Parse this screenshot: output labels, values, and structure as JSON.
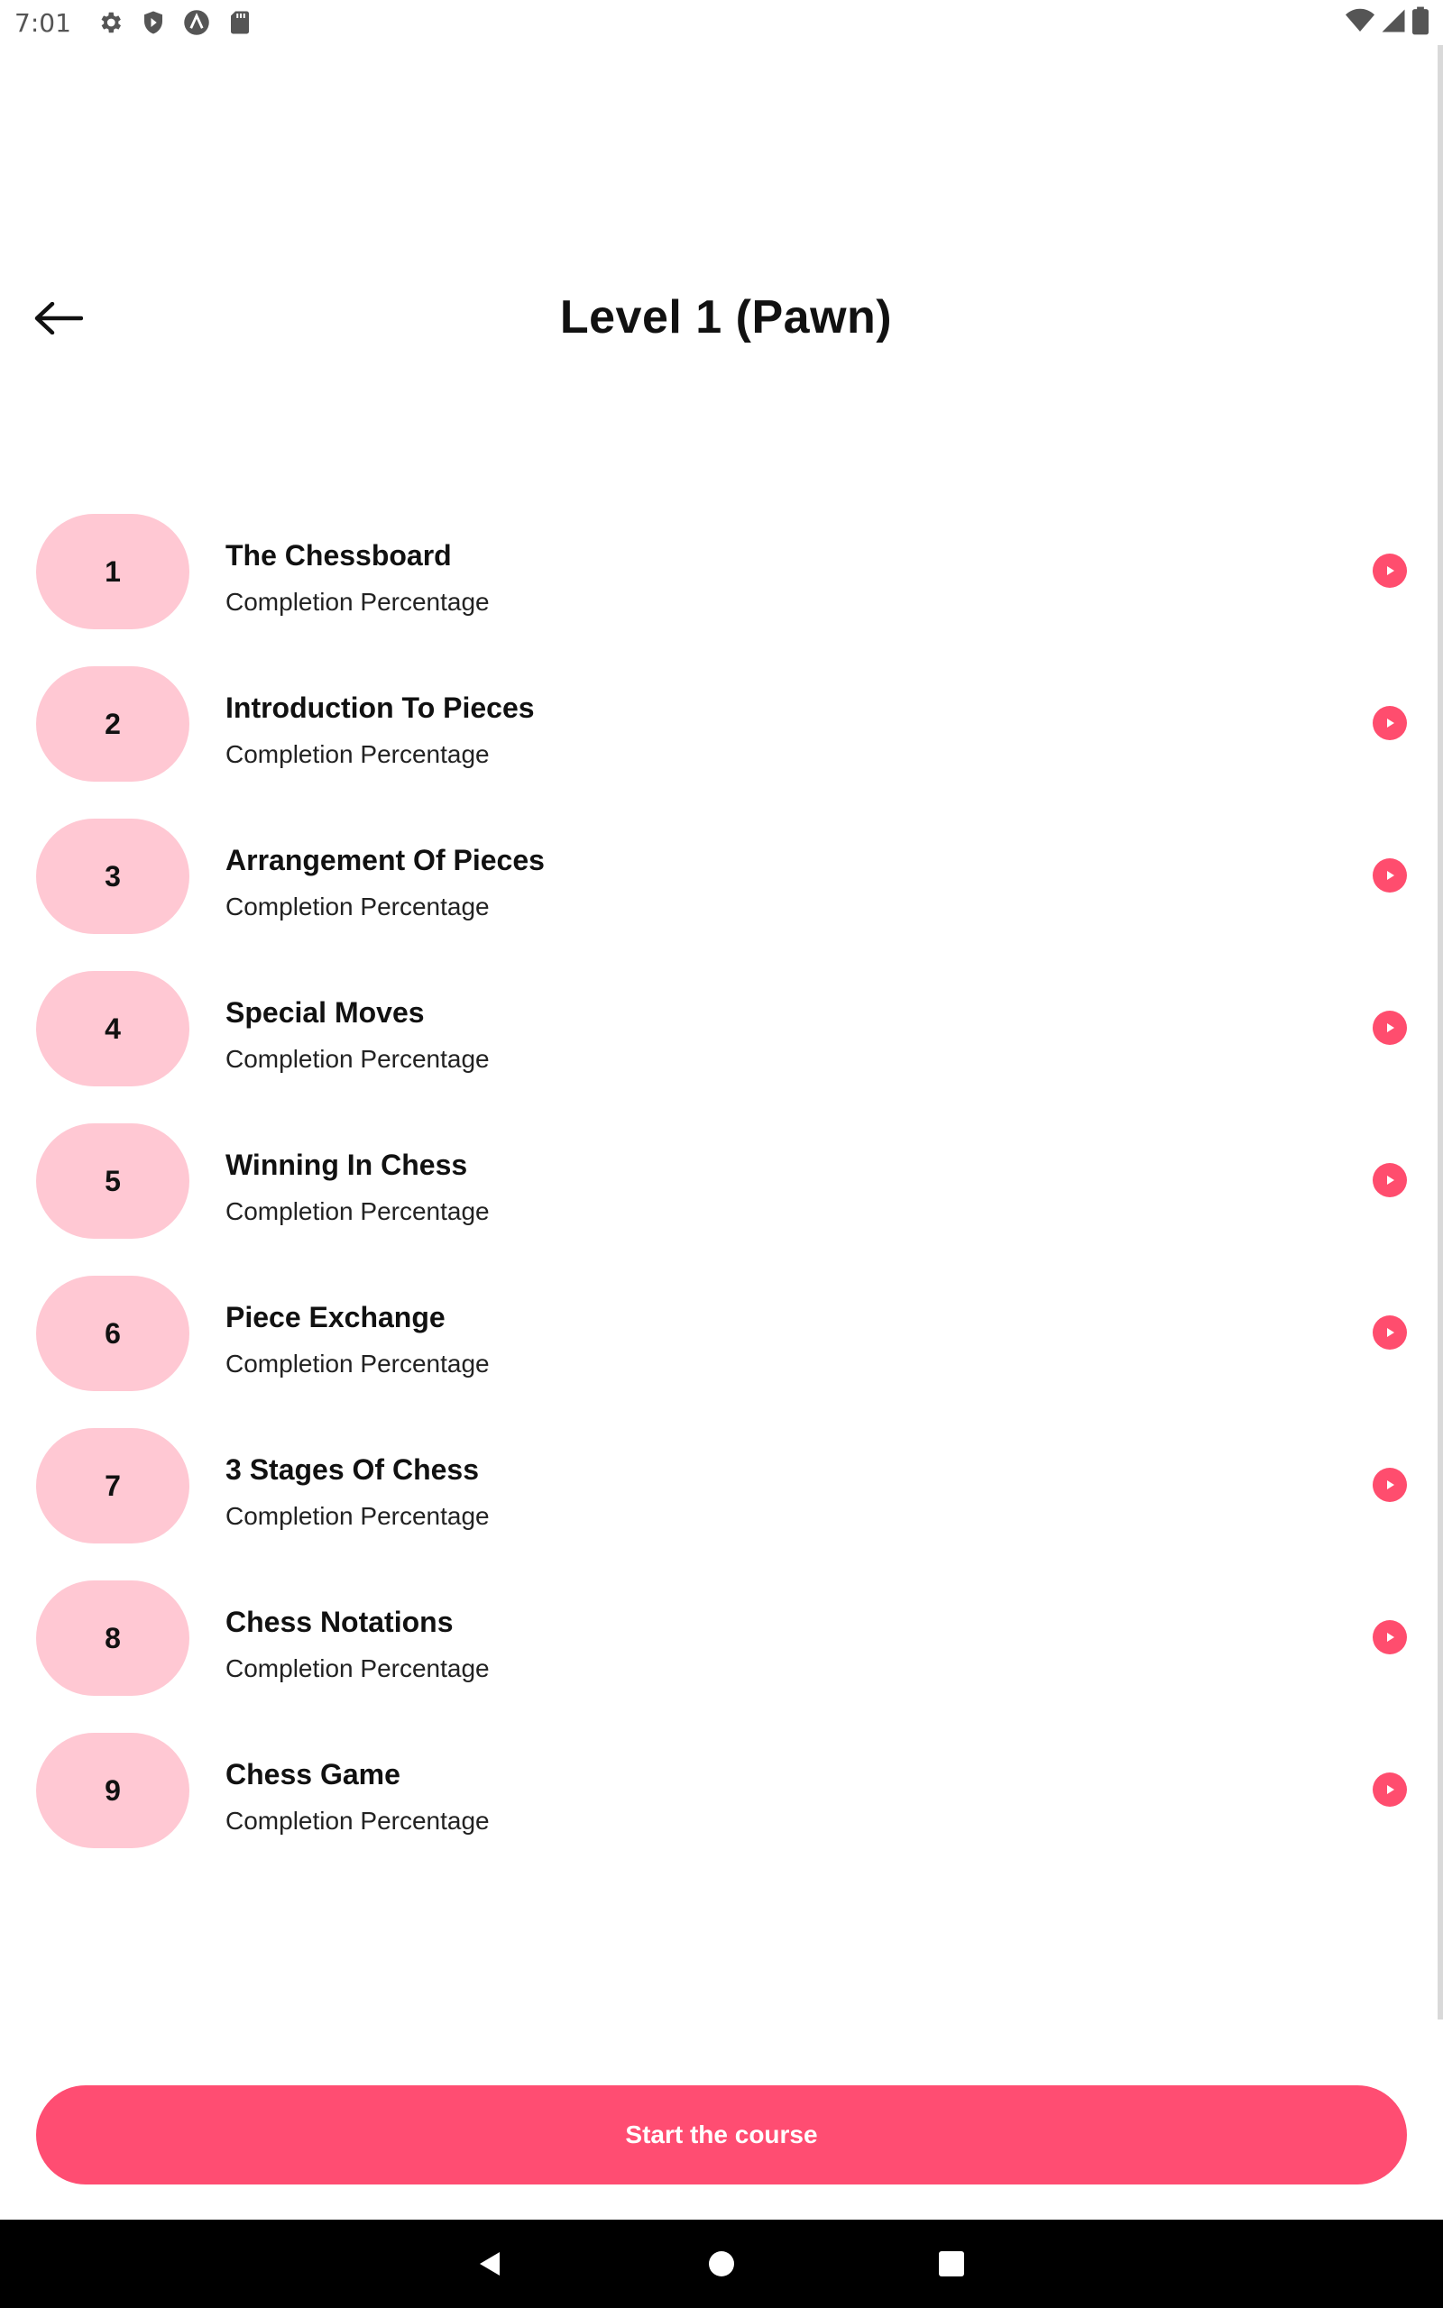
{
  "status_bar": {
    "time": "7:01",
    "left_icons": [
      "gear-icon",
      "shield-icon",
      "a-circle-icon",
      "sd-card-icon"
    ],
    "right_icons": [
      "wifi-icon",
      "signal-icon",
      "battery-icon"
    ]
  },
  "header": {
    "title": "Level 1 (Pawn)",
    "back_icon": "arrow-left-icon"
  },
  "lessons": [
    {
      "number": "1",
      "title": "The Chessboard",
      "subtitle": "Completion Percentage"
    },
    {
      "number": "2",
      "title": "Introduction To Pieces",
      "subtitle": "Completion Percentage"
    },
    {
      "number": "3",
      "title": "Arrangement Of Pieces",
      "subtitle": "Completion Percentage"
    },
    {
      "number": "4",
      "title": "Special Moves",
      "subtitle": "Completion Percentage"
    },
    {
      "number": "5",
      "title": "Winning In Chess",
      "subtitle": "Completion Percentage"
    },
    {
      "number": "6",
      "title": "Piece Exchange",
      "subtitle": "Completion Percentage"
    },
    {
      "number": "7",
      "title": "3 Stages Of Chess",
      "subtitle": "Completion Percentage"
    },
    {
      "number": "8",
      "title": "Chess Notations",
      "subtitle": "Completion Percentage"
    },
    {
      "number": "9",
      "title": "Chess Game",
      "subtitle": "Completion Percentage"
    }
  ],
  "cta": {
    "label": "Start the course"
  },
  "nav_bar": {
    "icons": [
      "back-triangle-icon",
      "home-circle-icon",
      "recents-square-icon"
    ]
  },
  "colors": {
    "accent": "#ff4d72",
    "badge_bg": "#ffc8d3",
    "play_bg": "#ff4d6e"
  }
}
